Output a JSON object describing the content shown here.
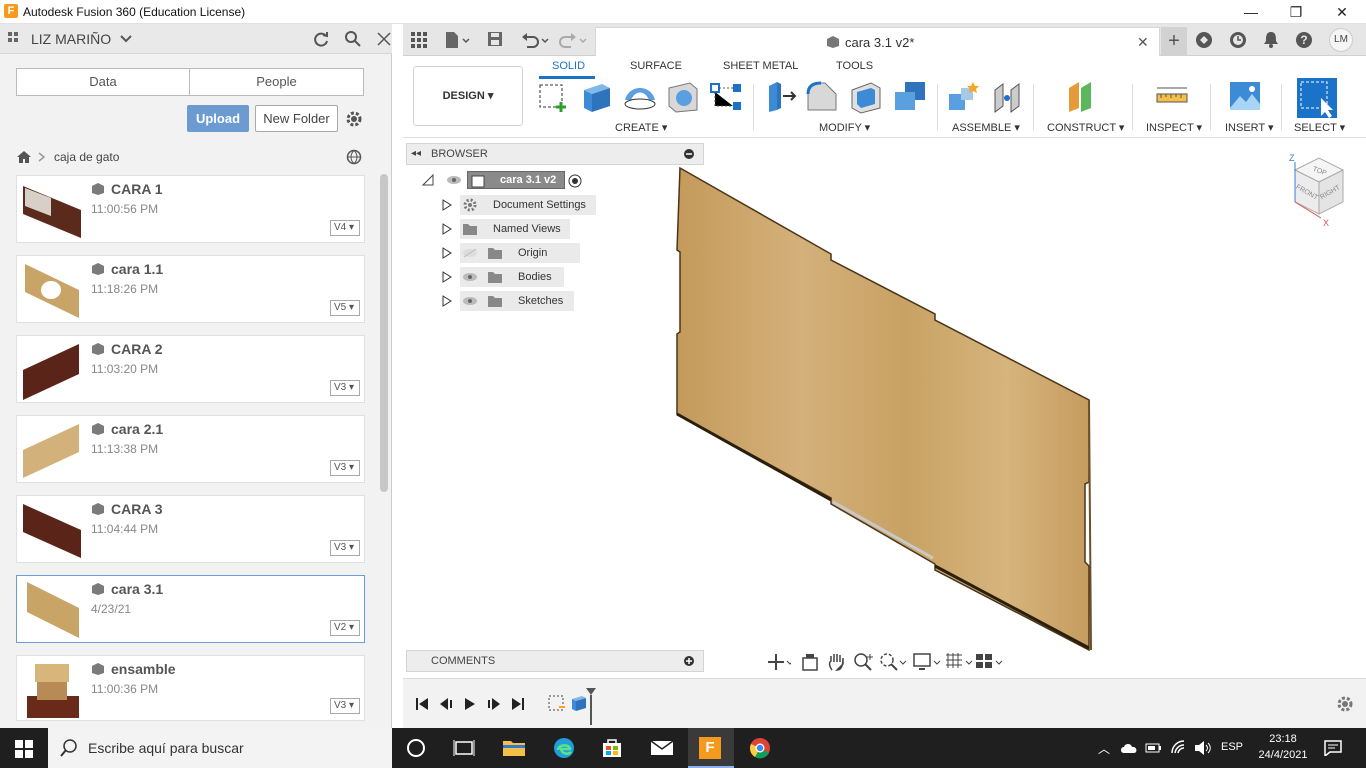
{
  "window": {
    "title": "Autodesk Fusion 360 (Education License)",
    "app_icon_letter": "F",
    "minimize": "—",
    "restore": "❐",
    "close": "✕"
  },
  "data_panel": {
    "user_name": "LIZ MARIÑO",
    "tabs": [
      "Data",
      "People"
    ],
    "upload_label": "Upload",
    "new_folder_label": "New Folder",
    "breadcrumb": "caja de gato",
    "items": [
      {
        "name": "CARA 1",
        "time": "11:00:56 PM",
        "version": "V4"
      },
      {
        "name": "cara 1.1",
        "time": "11:18:26 PM",
        "version": "V5"
      },
      {
        "name": "CARA 2",
        "time": "11:03:20 PM",
        "version": "V3"
      },
      {
        "name": "cara 2.1",
        "time": "11:13:38 PM",
        "version": "V3"
      },
      {
        "name": "CARA 3",
        "time": "11:04:44 PM",
        "version": "V3"
      },
      {
        "name": "cara 3.1",
        "time": "4/23/21",
        "version": "V2"
      },
      {
        "name": "ensamble",
        "time": "11:00:36 PM",
        "version": "V3"
      }
    ],
    "selected_index": 5
  },
  "document_tab": {
    "title": "cara 3.1 v2*",
    "close": "✕",
    "avatar_initials": "LM"
  },
  "ribbon": {
    "workspace": "DESIGN",
    "tabs": [
      "SOLID",
      "SURFACE",
      "SHEET METAL",
      "TOOLS"
    ],
    "active_tab": "SOLID",
    "groups": [
      "CREATE",
      "MODIFY",
      "ASSEMBLE",
      "CONSTRUCT",
      "INSPECT",
      "INSERT",
      "SELECT"
    ]
  },
  "browser": {
    "title": "BROWSER",
    "root": "cara 3.1 v2",
    "nodes": [
      "Document Settings",
      "Named Views",
      "Origin",
      "Bodies",
      "Sketches"
    ]
  },
  "comments": {
    "title": "COMMENTS"
  },
  "viewcube": {
    "top": "TOP",
    "front": "FRONT",
    "right": "RIGHT",
    "axis_z": "Z",
    "axis_x": "X"
  },
  "taskbar": {
    "search_placeholder": "Escribe aquí para buscar",
    "language": "ESP",
    "time": "23:18",
    "date": "24/4/2021"
  },
  "colors": {
    "accent": "#1a73c8",
    "upload": "#6b9bd1",
    "wood": "#c9a467",
    "taskbar": "#1f1f1f"
  }
}
